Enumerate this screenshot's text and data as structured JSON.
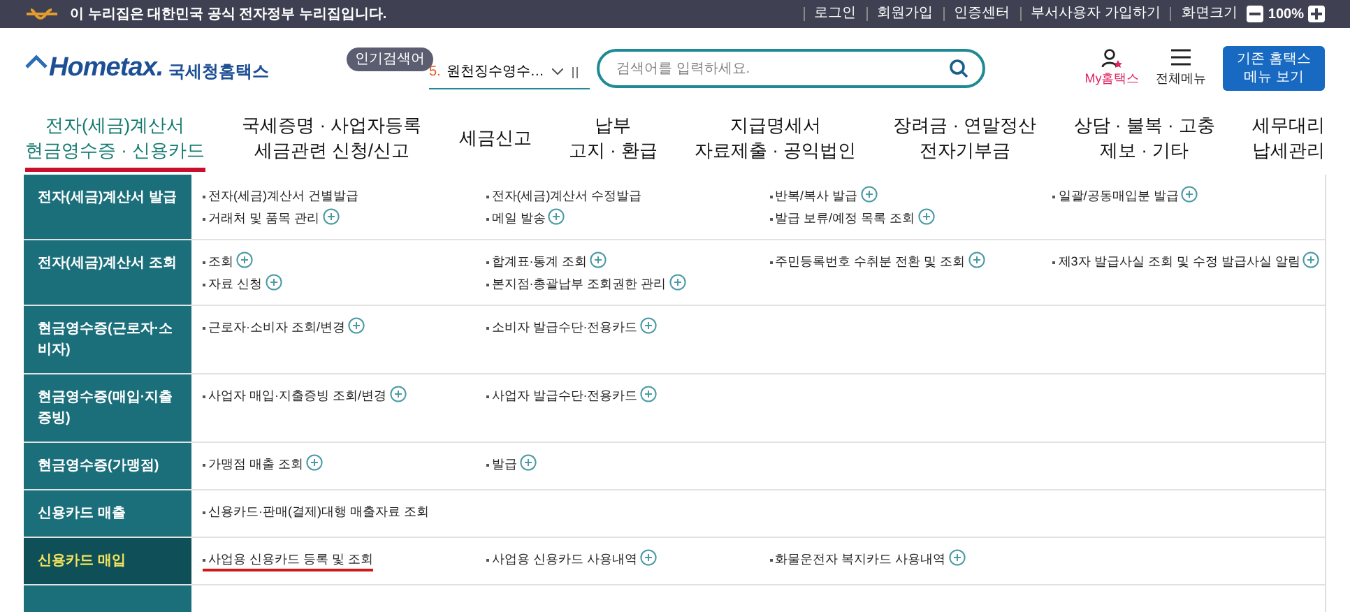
{
  "top_bar": {
    "notice": "이 누리집은 대한민국 공식 전자정부 누리집입니다.",
    "links": [
      "로그인",
      "회원가입",
      "인증센터",
      "부서사용자 가입하기",
      "화면크기"
    ],
    "zoom": "100%"
  },
  "header": {
    "logo": "Hometax.",
    "logo_caption": "국세청홈택스",
    "popular_label": "인기검색어",
    "popular_rank": "5.",
    "popular_term": "원천징수영수…",
    "search": {
      "placeholder": "검색어를 입력하세요."
    },
    "my_label": "My홈택스",
    "menu_label": "전체메뉴",
    "classic_button": "기존 홈택스\n메뉴 보기"
  },
  "nav": [
    {
      "label": "전자(세금)계산서\n현금영수증 · 신용카드",
      "selected": true
    },
    {
      "label": "국세증명 · 사업자등록\n세금관련 신청/신고",
      "selected": false
    },
    {
      "label": "세금신고",
      "selected": false
    },
    {
      "label": "납부\n고지 · 환급",
      "selected": false
    },
    {
      "label": "지급명세서\n자료제출 · 공익법인",
      "selected": false
    },
    {
      "label": "장려금 · 연말정산\n전자기부금",
      "selected": false
    },
    {
      "label": "상담 · 불복 · 고충\n제보 · 기타",
      "selected": false
    },
    {
      "label": "세무대리\n납세관리",
      "selected": false
    }
  ],
  "menu": [
    {
      "category": "전자(세금)계산서 발급",
      "selected": false,
      "items": [
        {
          "label": "전자(세금)계산서 건별발급",
          "more": false,
          "marked": false
        },
        {
          "label": "전자(세금)계산서 수정발급",
          "more": false,
          "marked": false
        },
        {
          "label": "반복/복사 발급",
          "more": true,
          "marked": false
        },
        {
          "label": "일괄/공동매입분 발급",
          "more": true,
          "marked": false
        },
        {
          "label": "거래처 및 품목 관리",
          "more": true,
          "marked": false
        },
        {
          "label": "메일 발송",
          "more": true,
          "marked": false
        },
        {
          "label": "발급 보류/예정 목록 조회",
          "more": true,
          "marked": false
        }
      ]
    },
    {
      "category": "전자(세금)계산서 조회",
      "selected": false,
      "items": [
        {
          "label": "조회",
          "more": true,
          "marked": false
        },
        {
          "label": "합계표·통계 조회",
          "more": true,
          "marked": false
        },
        {
          "label": "주민등록번호 수취분 전환 및 조회",
          "more": true,
          "marked": false
        },
        {
          "label": "제3자 발급사실 조회 및 수정 발급사실 알림",
          "more": true,
          "marked": false
        },
        {
          "label": "자료 신청",
          "more": true,
          "marked": false
        },
        {
          "label": "본지점·총괄납부 조회권한 관리",
          "more": true,
          "marked": false
        }
      ]
    },
    {
      "category": "현금영수증(근로자·소비자)",
      "selected": false,
      "items": [
        {
          "label": "근로자·소비자 조회/변경",
          "more": true,
          "marked": false
        },
        {
          "label": "소비자 발급수단·전용카드",
          "more": true,
          "marked": false
        }
      ]
    },
    {
      "category": "현금영수증(매입·지출증빙)",
      "selected": false,
      "items": [
        {
          "label": "사업자 매입·지출증빙 조회/변경",
          "more": true,
          "marked": false
        },
        {
          "label": "사업자 발급수단·전용카드",
          "more": true,
          "marked": false
        }
      ]
    },
    {
      "category": "현금영수증(가맹점)",
      "selected": false,
      "items": [
        {
          "label": "가맹점 매출 조회",
          "more": true,
          "marked": false
        },
        {
          "label": "발급",
          "more": true,
          "marked": false
        }
      ]
    },
    {
      "category": "신용카드 매출",
      "selected": false,
      "items": [
        {
          "label": "신용카드·판매(결제)대행 매출자료 조회",
          "more": false,
          "marked": false
        }
      ]
    },
    {
      "category": "신용카드 매입",
      "selected": true,
      "items": [
        {
          "label": "사업용 신용카드 등록 및 조회",
          "more": false,
          "marked": true
        },
        {
          "label": "사업용 신용카드 사용내역",
          "more": true,
          "marked": false
        },
        {
          "label": "화물운전자 복지카드 사용내역",
          "more": true,
          "marked": false
        }
      ]
    }
  ]
}
